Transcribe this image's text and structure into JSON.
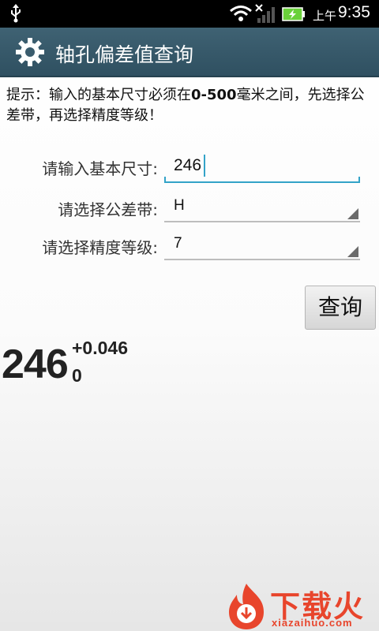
{
  "status_bar": {
    "time_prefix": "上午",
    "time": "9:35",
    "icons": [
      "usb-icon",
      "wifi-icon",
      "signal-icon",
      "battery-charging-icon"
    ],
    "battery_color": "#6ad13a"
  },
  "title_bar": {
    "title": "轴孔偏差值查询",
    "icon": "gear-icon",
    "color": "#35586a"
  },
  "hint": {
    "prefix": "提示：输入的基本尺寸必须在",
    "range": "0-500",
    "suffix": "毫米之间，先选择公差带，再选择精度等级！"
  },
  "form": {
    "size_label": "请输入基本尺寸:",
    "size_value": "246",
    "tolerance_label": "请选择公差带:",
    "tolerance_value": "H",
    "grade_label": "请选择精度等级:",
    "grade_value": "7",
    "accent_color": "#33a3c8"
  },
  "query_button": {
    "label": "查询"
  },
  "result": {
    "base": "246",
    "upper_deviation": "+0.046",
    "lower_deviation": "0"
  },
  "watermark": {
    "cn": "下载火",
    "en": "xiazaihuo.com",
    "color": "#e8452c"
  }
}
